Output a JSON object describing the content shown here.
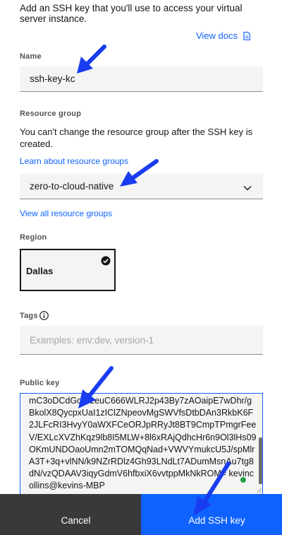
{
  "intro": {
    "text": "Add an SSH key that you'll use to access your virtual server instance."
  },
  "view_docs": {
    "label": "View docs",
    "icon": "document-icon"
  },
  "name_field": {
    "label": "Name",
    "value": "ssh-key-kc"
  },
  "resource_group": {
    "label": "Resource group",
    "helper": "You can't change the resource group after the SSH key is created.",
    "learn_link": "Learn about resource groups",
    "selected": "zero-to-cloud-native",
    "view_all_link": "View all resource groups"
  },
  "region": {
    "label": "Region",
    "selected": "Dallas"
  },
  "tags": {
    "label": "Tags",
    "placeholder": "Examples: env:dev, version-1"
  },
  "public_key": {
    "label": "Public key",
    "value": "mC3oDCdGoWzeuC666WLRJ2p43By7zAOaipE7wDhr/gBkolX8QycpxUaI1zIClZNpeovMgSWVfsDtbDAn3RkbK6F2JLFcRI3HvyY0aWXFCeORJpRRyJt8BT9CmpTPmgrFeeV/EXLcXVZhKqz9lb8I5MLW+8l6xRAjQdhcHr6n9Ol3lHs09OKmUNDOaoUmn2mTOMQqNad+VWVYmukcU5J/spMlrA3T+3q+vlNN/k9NZrRDlz4Gh93LNdLt7ADumMsnAu7tg8dN/vzQDAAV3iqyGdmV6hfbxiX6vvtppMkNkROM= kevincollins@kevins-MBP"
  },
  "footer": {
    "cancel_label": "Cancel",
    "primary_label": "Add SSH key"
  },
  "colors": {
    "accent": "#0f62fe",
    "annotation_arrow": "#1a3cf0",
    "footer_dark": "#393939",
    "field_bg": "#f4f4f4"
  }
}
